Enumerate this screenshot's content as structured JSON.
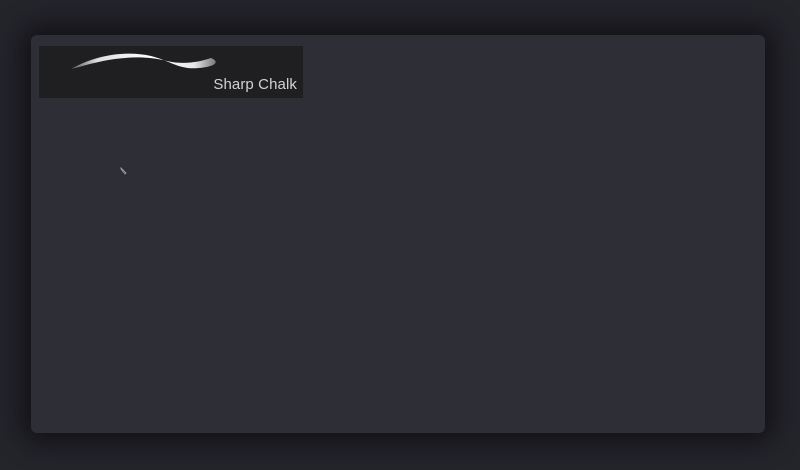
{
  "brush_library": {
    "selected_brush": {
      "name": "Sharp Chalk",
      "preview_icon": "brush-stroke-preview"
    }
  },
  "pointer": {
    "icon": "pencil-cursor-icon"
  },
  "colors": {
    "background": "#24242b",
    "panel": "#2e2e36",
    "tile": "#1f1f22",
    "text": "#d2d2d6",
    "stroke": "#ffffff"
  }
}
